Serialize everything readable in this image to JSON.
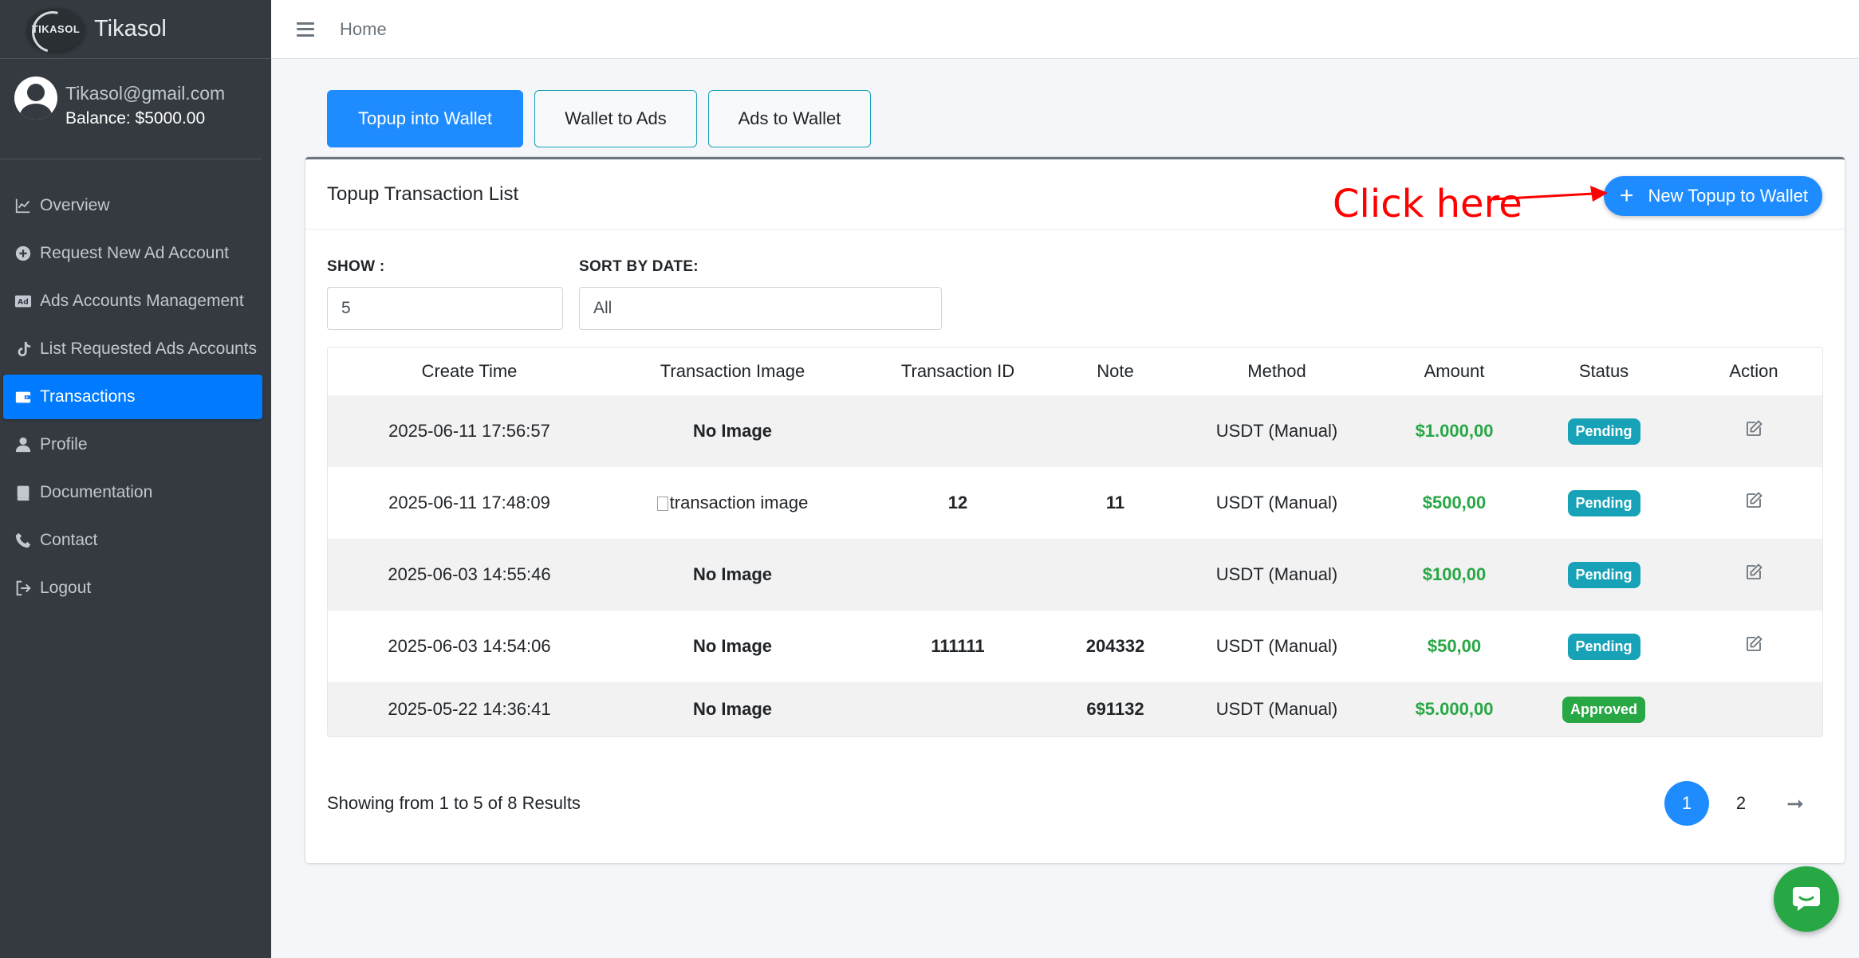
{
  "brand": {
    "logo_text": "TIKASOL",
    "name": "Tikasol"
  },
  "user": {
    "email": "Tikasol@gmail.com",
    "balance": "Balance: $5000.00"
  },
  "sidebar": {
    "items": [
      {
        "label": "Overview",
        "icon": "chart-line-icon"
      },
      {
        "label": "Request New Ad Account",
        "icon": "plus-circle-icon"
      },
      {
        "label": "Ads Accounts Management",
        "icon": "ad-icon"
      },
      {
        "label": "List Requested Ads Accounts",
        "icon": "tiktok-icon"
      },
      {
        "label": "Transactions",
        "icon": "wallet-icon",
        "active": true
      },
      {
        "label": "Profile",
        "icon": "user-icon"
      },
      {
        "label": "Documentation",
        "icon": "book-icon"
      },
      {
        "label": "Contact",
        "icon": "phone-icon"
      },
      {
        "label": "Logout",
        "icon": "logout-icon"
      }
    ]
  },
  "header": {
    "breadcrumb": "Home"
  },
  "tabs": [
    {
      "label": "Topup into Wallet",
      "active": true
    },
    {
      "label": "Wallet to Ads"
    },
    {
      "label": "Ads to Wallet"
    }
  ],
  "card": {
    "title": "Topup Transaction List",
    "new_button": "New Topup to Wallet",
    "annotation": "Click here"
  },
  "filters": {
    "show_label": "SHOW :",
    "show_value": "5",
    "sort_label": "SORT BY DATE:",
    "sort_value": "All"
  },
  "table": {
    "headers": [
      "Create Time",
      "Transaction Image",
      "Transaction ID",
      "Note",
      "Method",
      "Amount",
      "Status",
      "Action"
    ],
    "rows": [
      {
        "time": "2025-06-11 17:56:57",
        "image": "No Image",
        "txid": "",
        "note": "",
        "method": "USDT (Manual)",
        "amount": "$1.000,00",
        "status": "Pending"
      },
      {
        "time": "2025-06-11 17:48:09",
        "image": "transaction image",
        "txid": "12",
        "note": "11",
        "method": "USDT (Manual)",
        "amount": "$500,00",
        "status": "Pending"
      },
      {
        "time": "2025-06-03 14:55:46",
        "image": "No Image",
        "txid": "",
        "note": "",
        "method": "USDT (Manual)",
        "amount": "$100,00",
        "status": "Pending"
      },
      {
        "time": "2025-06-03 14:54:06",
        "image": "No Image",
        "txid": "111111",
        "note": "204332",
        "method": "USDT (Manual)",
        "amount": "$50,00",
        "status": "Pending"
      },
      {
        "time": "2025-05-22 14:36:41",
        "image": "No Image",
        "txid": "",
        "note": "691132",
        "method": "USDT (Manual)",
        "amount": "$5.000,00",
        "status": "Approved"
      }
    ]
  },
  "pagination": {
    "summary": "Showing from 1 to 5 of 8 Results",
    "pages": [
      "1",
      "2"
    ],
    "next": "➞"
  },
  "colors": {
    "accent": "#1e8cff",
    "sidebar": "#343a40",
    "success": "#28a745",
    "info": "#17a2b8",
    "annotation": "#ff0000"
  }
}
